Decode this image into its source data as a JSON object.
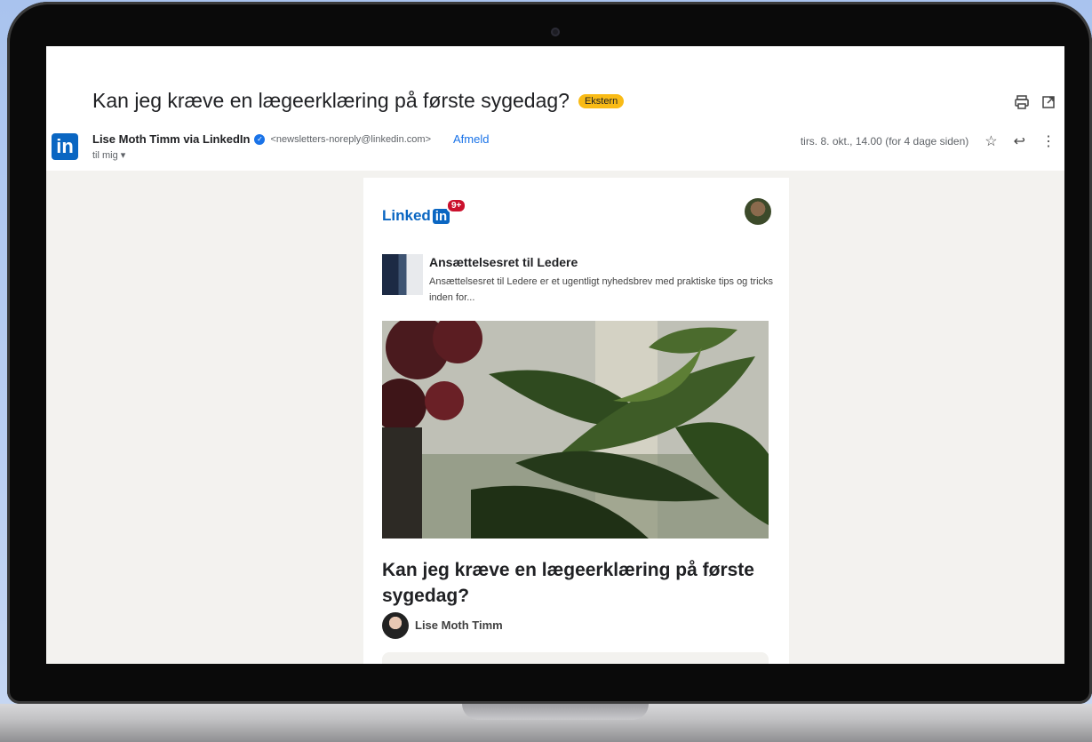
{
  "email": {
    "subject": "Kan jeg kræve en lægeerklæring på første sygedag?",
    "external_badge": "Ekstern",
    "sender_name": "Lise Moth Timm via LinkedIn",
    "sender_email": "<newsletters-noreply@linkedin.com>",
    "unsubscribe_label": "Afmeld",
    "to_label": "til mig",
    "date": "tirs. 8. okt., 14.00 (for 4 dage siden)",
    "sender_avatar_text": "in"
  },
  "newsletter": {
    "logo_text": "Linked",
    "logo_in": "in",
    "notification_count": "9+",
    "title": "Ansættelsesret til Ledere",
    "description": "Ansættelsesret til Ledere er et ugentligt nyhedsbrev med praktiske tips og tricks inden for...",
    "article_title": "Kan jeg kræve en lægeerklæring på første sygedag?",
    "author": "Lise Moth Timm"
  },
  "colors": {
    "linkedin_blue": "#0a66c2",
    "badge_yellow": "#f9bb16",
    "notif_red": "#cb112d",
    "link_blue": "#1a73e8"
  },
  "icons": {
    "print": "print-icon",
    "open_new": "open-in-new-icon",
    "star": "star-icon",
    "reply": "reply-icon",
    "more": "more-vert-icon",
    "verified": "verified-icon",
    "dropdown": "caret-down-icon"
  }
}
